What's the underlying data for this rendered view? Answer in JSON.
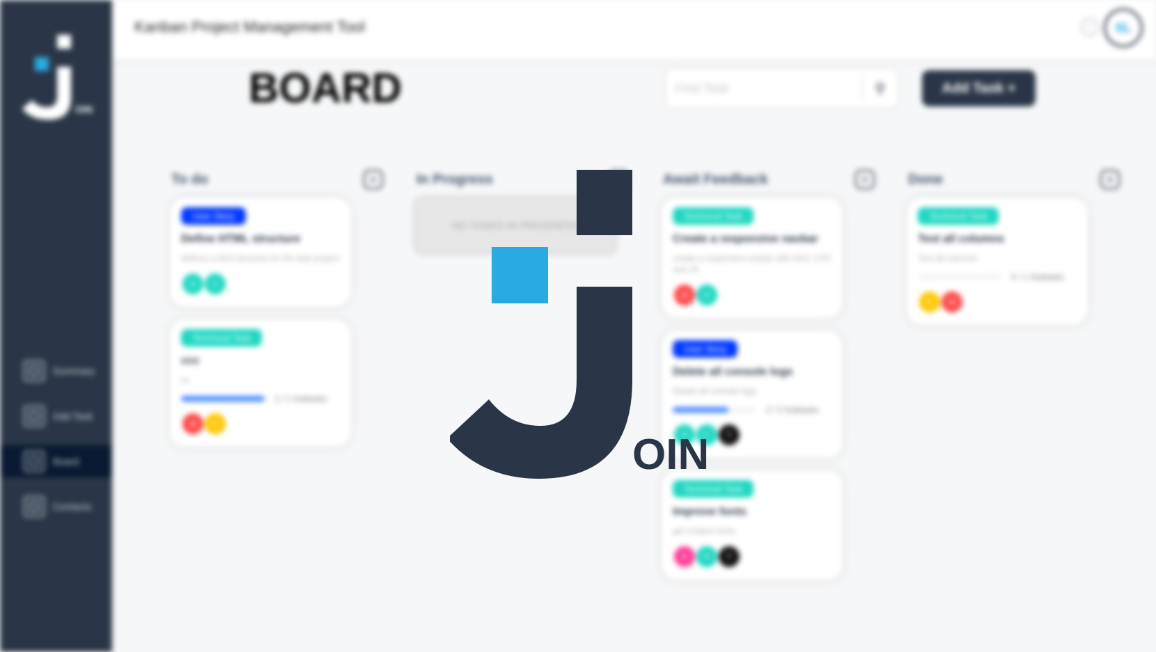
{
  "app": {
    "header_title": "Kanban Project Management Tool",
    "help_glyph": "?",
    "user_initials": "SL",
    "sidebar_logo_suffix": "OIN",
    "splash_suffix": "OIN"
  },
  "sidebar": {
    "items": [
      {
        "label": "Summary",
        "icon": "summary-icon"
      },
      {
        "label": "Add Task",
        "icon": "edit-icon"
      },
      {
        "label": "Board",
        "icon": "board-icon",
        "active": true
      },
      {
        "label": "Contacts",
        "icon": "contacts-icon"
      }
    ]
  },
  "board": {
    "title": "BOARD",
    "search_placeholder": "Find Task",
    "add_task_label": "Add Task +",
    "plus_glyph": "+"
  },
  "columns": [
    {
      "title": "To do",
      "cards": [
        {
          "category": "User Story",
          "category_color": "#0038ff",
          "title": "Define HTML structure",
          "description": "defines a html structure for the task project",
          "avatars": [
            {
              "initials": "H",
              "color": "#1fd7c1"
            },
            {
              "initials": "C",
              "color": "#1fd7c1"
            }
          ]
        },
        {
          "category": "Technical Task",
          "category_color": "#1fd7c1",
          "title": "ccc",
          "description": "cc",
          "progress": 1.0,
          "progress_label": "1 / 1 Subtasks",
          "avatars": [
            {
              "initials": "M",
              "color": "#ff4646"
            },
            {
              "initials": "E",
              "color": "#ffc701"
            }
          ]
        }
      ]
    },
    {
      "title": "In Progress",
      "empty_text": "NO TASKS IN PROGRESS",
      "cards": []
    },
    {
      "title": "Await Feedback",
      "cards": [
        {
          "category": "Technical Task",
          "category_color": "#1fd7c1",
          "title": "Create a responsive navbar",
          "description": "create a responsive navbar with html, CSS and JS",
          "avatars": [
            {
              "initials": "M",
              "color": "#ff4646"
            },
            {
              "initials": "H",
              "color": "#1fd7c1"
            }
          ]
        },
        {
          "category": "User Story",
          "category_color": "#0038ff",
          "title": "Delete all console logs",
          "description": "Delete all console logs",
          "progress": 0.67,
          "progress_label": "2 / 3 Subtasks",
          "avatars": [
            {
              "initials": "H",
              "color": "#1fd7c1"
            },
            {
              "initials": "C",
              "color": "#1fd7c1"
            },
            {
              "initials": "T",
              "color": "#111111"
            }
          ]
        },
        {
          "category": "Technical Task",
          "category_color": "#1fd7c1",
          "title": "Improve fonts",
          "description": "get modern fonts",
          "avatars": [
            {
              "initials": "A",
              "color": "#ff3d98"
            },
            {
              "initials": "H",
              "color": "#1fd7c1"
            },
            {
              "initials": "T",
              "color": "#111111"
            }
          ]
        }
      ]
    },
    {
      "title": "Done",
      "cards": [
        {
          "category": "Technical Task",
          "category_color": "#1fd7c1",
          "title": "Test all columns",
          "description": "Test all columns",
          "progress": 0.0,
          "progress_label": "0 / 1 Subtasks",
          "avatars": [
            {
              "initials": "E",
              "color": "#ffc701"
            },
            {
              "initials": "M",
              "color": "#ff4646"
            }
          ]
        }
      ]
    }
  ],
  "colors": {
    "sidebar_bg": "#2a3647",
    "logo_accent": "#29abe2",
    "active_nav": "#091931"
  }
}
